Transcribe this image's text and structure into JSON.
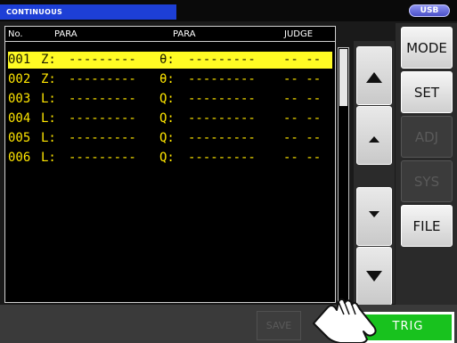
{
  "title": "CONTINUOUS",
  "usb_badge": "USB",
  "headers": {
    "no": "No.",
    "para1": "PARA",
    "para2": "PARA",
    "judge": "JUDGE"
  },
  "rows": [
    {
      "no": "001",
      "p1": "Z:",
      "v1": "---------",
      "p2": "θ:",
      "v2": "---------",
      "judge": "-- --"
    },
    {
      "no": "002",
      "p1": "Z:",
      "v1": "---------",
      "p2": "θ:",
      "v2": "---------",
      "judge": "-- --"
    },
    {
      "no": "003",
      "p1": "L:",
      "v1": "---------",
      "p2": "Q:",
      "v2": "---------",
      "judge": "-- --"
    },
    {
      "no": "004",
      "p1": "L:",
      "v1": "---------",
      "p2": "Q:",
      "v2": "---------",
      "judge": "-- --"
    },
    {
      "no": "005",
      "p1": "L:",
      "v1": "---------",
      "p2": "Q:",
      "v2": "---------",
      "judge": "-- --"
    },
    {
      "no": "006",
      "p1": "L:",
      "v1": "---------",
      "p2": "Q:",
      "v2": "---------",
      "judge": "-- --"
    }
  ],
  "menu": {
    "mode": "MODE",
    "set": "SET",
    "adj": "ADJ",
    "sys": "SYS",
    "file": "FILE"
  },
  "bottom": {
    "save": "SAVE",
    "trig": "TRIG"
  },
  "colors": {
    "accent_blue": "#1d3fd6",
    "row_text": "#ffe600",
    "selected_row": "#fffb24",
    "trig_green": "#18c21e"
  }
}
